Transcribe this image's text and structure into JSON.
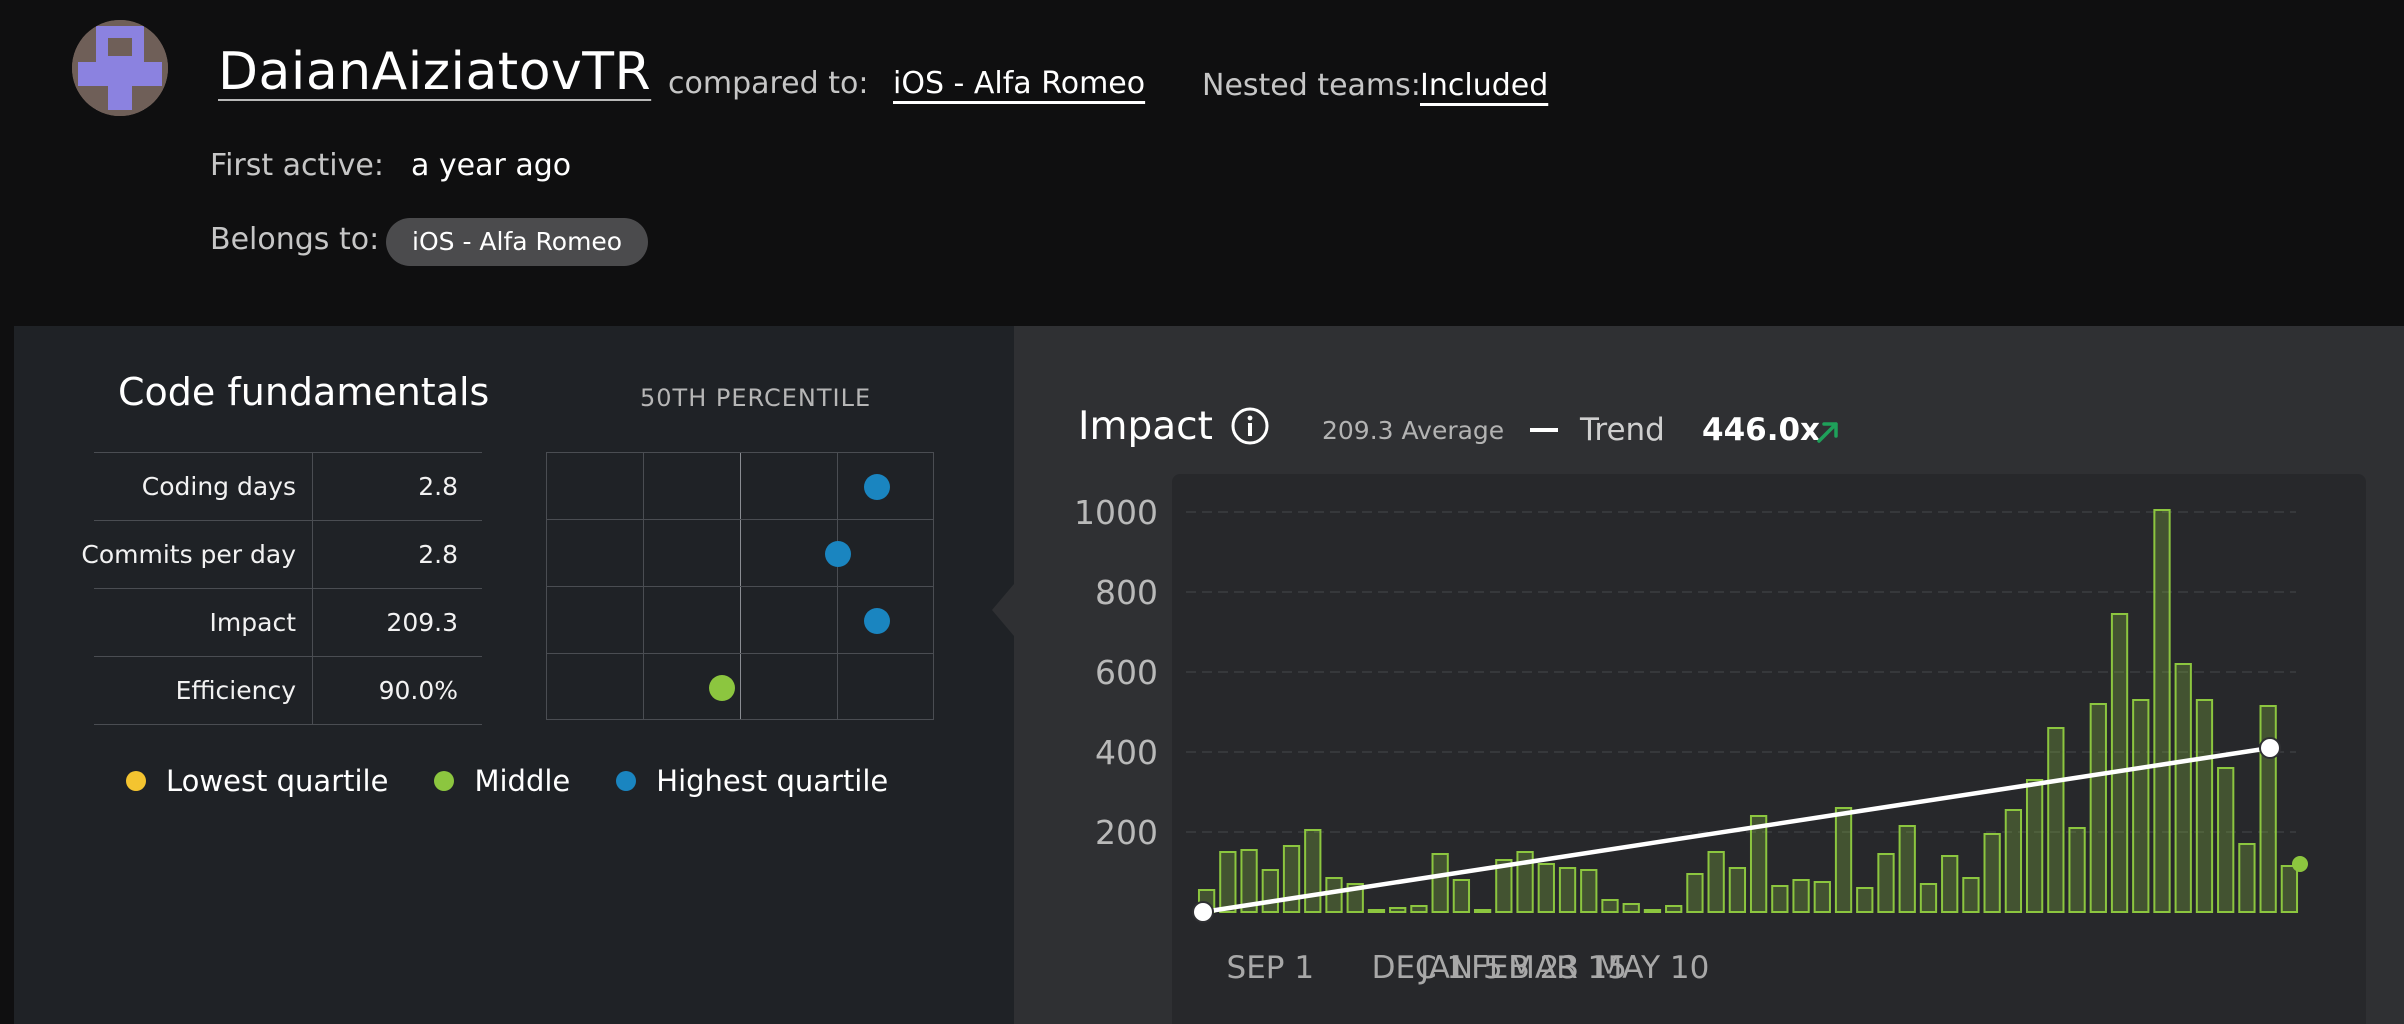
{
  "header": {
    "username": "DaianAiziatovTR",
    "compared_label": "compared to:",
    "compared_value": "iOS - Alfa Romeo",
    "nested_label": "Nested teams:",
    "nested_value": "Included",
    "first_active_label": "First active:",
    "first_active_value": "a year ago",
    "belongs_label": "Belongs to:",
    "belongs_value": "iOS - Alfa Romeo"
  },
  "fundamentals": {
    "title": "Code fundamentals",
    "percentile_title": "50TH PERCENTILE",
    "metrics": [
      {
        "name": "Coding days",
        "value": "2.8",
        "percentile": 0.85,
        "color": "#1a85c0"
      },
      {
        "name": "Commits per day",
        "value": "2.8",
        "percentile": 0.75,
        "color": "#1a85c0"
      },
      {
        "name": "Impact",
        "value": "209.3",
        "percentile": 0.85,
        "color": "#1a85c0"
      },
      {
        "name": "Efficiency",
        "value": "90.0%",
        "percentile": 0.45,
        "color": "#8cc63f"
      }
    ],
    "legend": [
      {
        "label": "Lowest quartile",
        "color": "#f4c430"
      },
      {
        "label": "Middle",
        "color": "#8cc63f"
      },
      {
        "label": "Highest quartile",
        "color": "#1a85c0"
      }
    ]
  },
  "impact": {
    "title": "Impact",
    "average_text": "209.3 Average",
    "trend_label": "Trend",
    "trend_value": "446.0x",
    "trend_color": "#1fa05a",
    "info_icon": "info-icon"
  },
  "chart_data": {
    "type": "bar",
    "title": "Impact",
    "ylim": [
      0,
      1000
    ],
    "yticks": [
      200,
      400,
      600,
      800,
      1000
    ],
    "xticks": [
      "SEP 1",
      "DEC 1",
      "JAN 5",
      "FEB 23",
      "MAR 15",
      "MAY 10"
    ],
    "xtick_positions": [
      3,
      10,
      12,
      15,
      17,
      21
    ],
    "grid": true,
    "bar_color": "#8cc63f",
    "values": [
      55,
      150,
      155,
      105,
      165,
      205,
      85,
      70,
      5,
      10,
      15,
      145,
      80,
      0,
      130,
      150,
      120,
      110,
      105,
      30,
      20,
      0,
      15,
      95,
      150,
      110,
      240,
      65,
      80,
      75,
      260,
      60,
      145,
      215,
      70,
      140,
      85,
      195,
      255,
      330,
      460,
      210,
      520,
      745,
      530,
      1005,
      620,
      530,
      360,
      170,
      515,
      115
    ],
    "trend_line": {
      "start": 0,
      "end": 410,
      "color": "#ffffff"
    },
    "last_point": 120
  }
}
